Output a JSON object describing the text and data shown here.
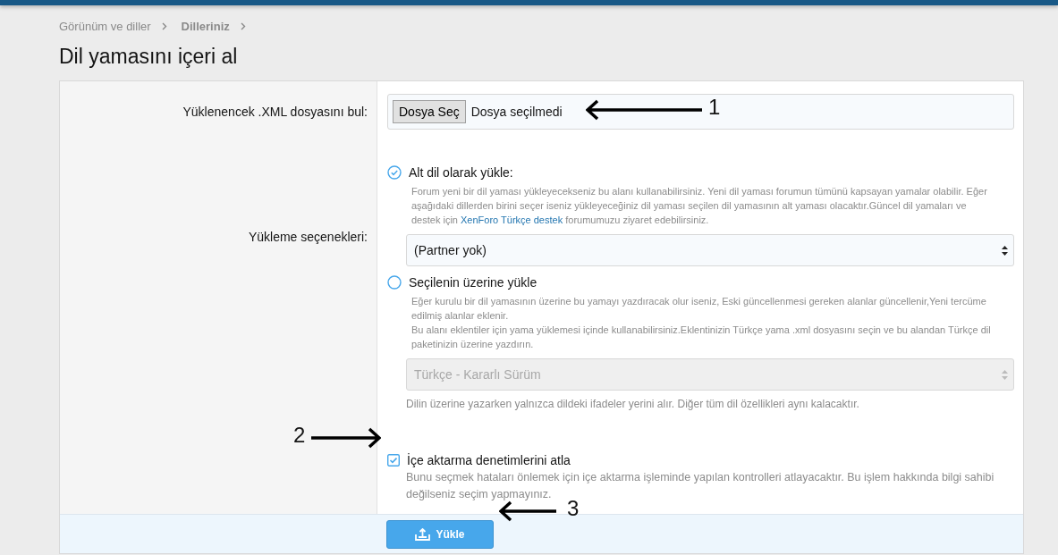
{
  "breadcrumb": [
    {
      "label": "Görünüm ve diller",
      "current": false
    },
    {
      "label": "Dilleriniz",
      "current": true
    }
  ],
  "title": "Dil yamasını içeri al",
  "file_row": {
    "label": "Yüklenencek .XML dosyasını bul:",
    "button": "Dosya Seç",
    "status": "Dosya seçilmedi"
  },
  "options_row": {
    "label": "Yükleme seçenekleri:",
    "options": [
      {
        "label": "Alt dil olarak yükle:",
        "selected": true,
        "description": [
          "Forum yeni bir dil yaması yükleyecekseniz bu alanı kullanabilirsiniz. Yeni dil yaması forumun tümünü kapsayan yamalar olabilir. Eğer aşağıdaki dillerden birini seçer iseniz yükleyeceğiniz dil yaması seçilen dil yamasının alt yaması olacaktır.Güncel dil yamaları ve destek için "
        ],
        "link": "XenForo Türkçe destek",
        "after_link": " forumumuzu ziyaret edebilirsiniz.",
        "select": {
          "value": "(Partner yok)",
          "disabled": false
        }
      },
      {
        "label": "Seçilenin üzerine yükle",
        "selected": false,
        "description": [
          "Eğer kurulu bir dil yamasının üzerine bu yamayı yazdıracak olur iseniz, Eski güncellenmesi gereken alanlar güncellenir,Yeni tercüme edilmiş alanlar eklenir.",
          "Bu alanı eklentiler için yama yüklemesi içinde kullanabilirsiniz.Eklentinizin Türkçe yama .xml dosyasını seçin ve bu alandan Türkçe dil paketinizin üzerine yazdırın."
        ],
        "select": {
          "value": "Türkçe - Kararlı Sürüm",
          "disabled": true
        },
        "hint": "Dilin üzerine yazarken yalnızca dildeki ifadeler yerini alır. Diğer tüm dil özellikleri aynı kalacaktır."
      }
    ]
  },
  "skip_checks": {
    "label": "İçe aktarma denetimlerini atla",
    "checked": true,
    "description": "Bunu seçmek hataları önlemek için içe aktarma işleminde yapılan kontrolleri atlayacaktır. Bu işlem hakkında bilgi sahibi değilseniz seçim yapmayınız."
  },
  "submit": {
    "label": "Yükle"
  },
  "annotations": [
    {
      "label": "1"
    },
    {
      "label": "2"
    },
    {
      "label": "3"
    }
  ]
}
